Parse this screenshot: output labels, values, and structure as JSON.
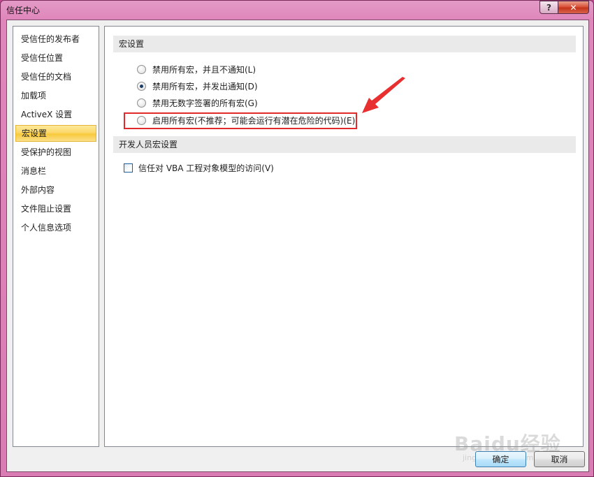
{
  "window": {
    "title": "信任中心",
    "help_label": "?",
    "close_label": "✕"
  },
  "sidebar": {
    "items": [
      {
        "label": "受信任的发布者"
      },
      {
        "label": "受信任位置"
      },
      {
        "label": "受信任的文档"
      },
      {
        "label": "加载项"
      },
      {
        "label": "ActiveX 设置"
      },
      {
        "label": "宏设置",
        "selected": true
      },
      {
        "label": "受保护的视图"
      },
      {
        "label": "消息栏"
      },
      {
        "label": "外部内容"
      },
      {
        "label": "文件阻止设置"
      },
      {
        "label": "个人信息选项"
      }
    ]
  },
  "macro_settings": {
    "header": "宏设置",
    "options": [
      {
        "label": "禁用所有宏，并且不通知(L)",
        "checked": false
      },
      {
        "label": "禁用所有宏，并发出通知(D)",
        "checked": true
      },
      {
        "label": "禁用无数字签署的所有宏(G)",
        "checked": false
      },
      {
        "label": "启用所有宏(不推荐；可能会运行有潜在危险的代码)(E)",
        "checked": false
      }
    ]
  },
  "developer_settings": {
    "header": "开发人员宏设置",
    "vba_access_label": "信任对 VBA 工程对象模型的访问(V)",
    "vba_access_checked": false
  },
  "footer": {
    "ok_label": "确定",
    "cancel_label": "取消"
  },
  "watermark": {
    "text": "Baidu经验",
    "sub": "jingyan.baidu.com"
  },
  "colors": {
    "annotation": "#e12a2a",
    "selected_nav": "#f9c93a",
    "title_bar": "#df86bb"
  }
}
